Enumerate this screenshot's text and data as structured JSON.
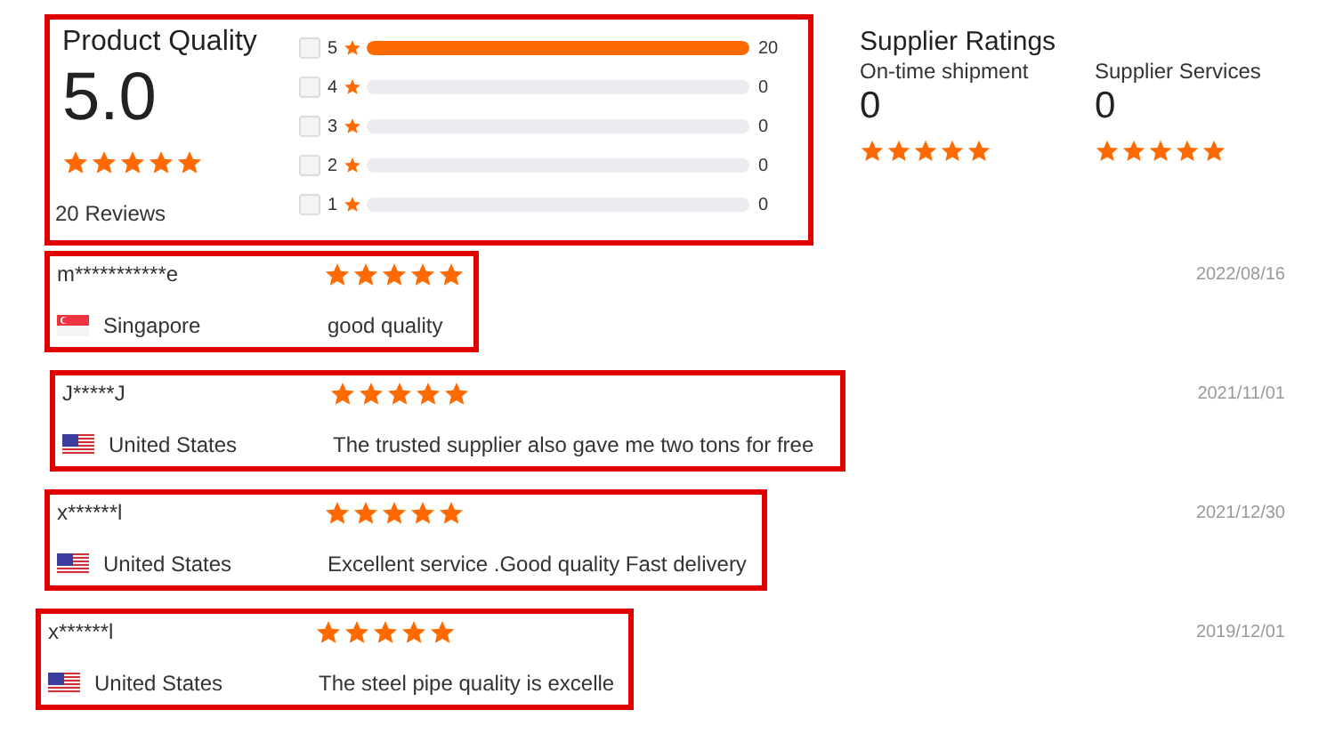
{
  "product_quality": {
    "title": "Product Quality",
    "score": "5.0",
    "stars": 5,
    "reviews_count": "20",
    "reviews_label": "Reviews",
    "breakdown": [
      {
        "label": "5",
        "checked": false,
        "level": 1,
        "count": "20"
      },
      {
        "label": "4",
        "checked": false,
        "level": 0,
        "count": "0"
      },
      {
        "label": "3",
        "checked": false,
        "level": 0,
        "count": "0"
      },
      {
        "label": "2",
        "checked": false,
        "level": 0,
        "count": "0"
      },
      {
        "label": "1",
        "checked": false,
        "level": 0,
        "count": "0"
      }
    ]
  },
  "supplier_ratings": {
    "title": "Supplier Ratings",
    "items": [
      {
        "label": "On-time shipment",
        "score": "0",
        "stars": 5
      },
      {
        "label": "Supplier Services",
        "score": "0",
        "stars": 5
      }
    ]
  },
  "reviews": [
    {
      "user": "m***********e",
      "kind": "sg",
      "country": "Singapore",
      "stars": 5,
      "text": "good quality",
      "date": "2022/08/16"
    },
    {
      "user": "J*****J",
      "kind": "us",
      "country": "United States",
      "stars": 5,
      "text": "The trusted supplier also gave me two tons for free",
      "date": "2021/11/01"
    },
    {
      "user": "x******l",
      "kind": "us",
      "country": "United States",
      "stars": 5,
      "text": "Excellent service .Good quality Fast delivery",
      "date": "2021/12/30"
    },
    {
      "user": "x******l",
      "kind": "us",
      "country": "United States",
      "stars": 5,
      "text": "The steel pipe quality is excelle",
      "date": "2019/12/01"
    }
  ]
}
